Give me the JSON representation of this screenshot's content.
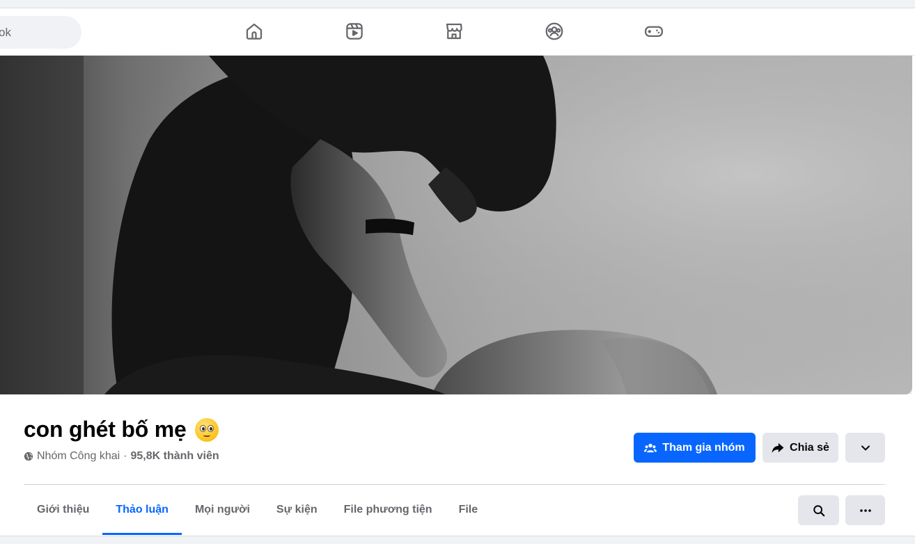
{
  "search": {
    "placeholder_visible": "ok"
  },
  "nav": {
    "icons": [
      "home-icon",
      "reels-icon",
      "marketplace-icon",
      "groups-icon",
      "gaming-icon"
    ]
  },
  "group": {
    "name": "con ghét bố mẹ",
    "emoji": "face-with-pleading-eyes",
    "privacy": "Nhóm Công khai",
    "separator": "·",
    "members": "95,8K thành viên"
  },
  "actions": {
    "join_label": "Tham gia nhóm",
    "share_label": "Chia sẻ"
  },
  "tabs": [
    {
      "label": "Giới thiệu",
      "active": false
    },
    {
      "label": "Thảo luận",
      "active": true
    },
    {
      "label": "Mọi người",
      "active": false
    },
    {
      "label": "Sự kiện",
      "active": false
    },
    {
      "label": "File phương tiện",
      "active": false
    },
    {
      "label": "File",
      "active": false
    }
  ],
  "colors": {
    "accent": "#0866ff",
    "button_gray": "#e4e6eb",
    "muted_text": "#65676b"
  }
}
